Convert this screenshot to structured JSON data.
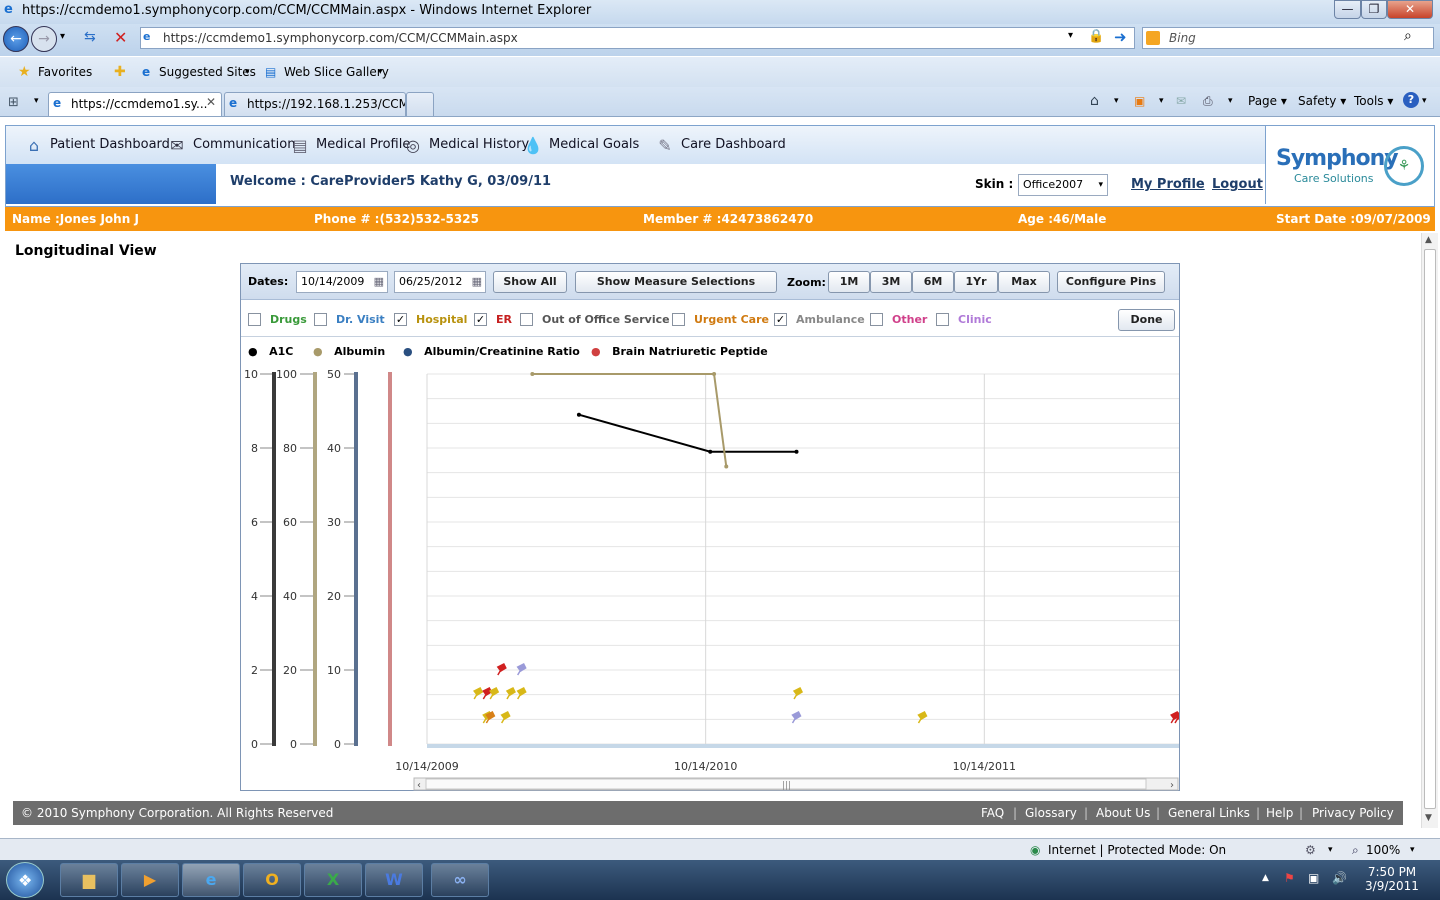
{
  "window": {
    "title": "https://ccmdemo1.symphonycorp.com/CCM/CCMMain.aspx - Windows Internet Explorer",
    "url": "https://ccmdemo1.symphonycorp.com/CCM/CCMMain.aspx",
    "search_placeholder": "Bing",
    "min_icon": "minimize-icon",
    "max_icon": "maximize-icon",
    "close_icon": "close-icon"
  },
  "favbar": {
    "favorites": "Favorites",
    "suggested": "Suggested Sites",
    "webslice": "Web Slice Gallery"
  },
  "tabs": [
    {
      "label": "https://ccmdemo1.sy..."
    },
    {
      "label": "https://192.168.1.253/CCM..."
    }
  ],
  "commandbar": {
    "page": "Page",
    "safety": "Safety",
    "tools": "Tools"
  },
  "nav": {
    "items": [
      {
        "label": "Patient Dashboard",
        "icon": "home-icon"
      },
      {
        "label": "Communication",
        "icon": "envelope-icon"
      },
      {
        "label": "Medical Profile",
        "icon": "clipboard-icon"
      },
      {
        "label": "Medical History",
        "icon": "spiral-icon"
      },
      {
        "label": "Medical Goals",
        "icon": "droplet-icon"
      },
      {
        "label": "Care Dashboard",
        "icon": "stethoscope-icon"
      }
    ]
  },
  "welcome": "Welcome : CareProvider5 Kathy G, 03/09/11",
  "skin": {
    "label": "Skin :",
    "value": "Office2007"
  },
  "links": {
    "profile": "My Profile",
    "logout": "Logout"
  },
  "logo": {
    "name": "Symphony",
    "tagline": "Care Solutions"
  },
  "patient": {
    "name": "Name :Jones John J",
    "phone": "Phone # :(532)532-5325",
    "member": "Member # :42473862470",
    "age": "Age :46/Male",
    "start": "Start Date :09/07/2009"
  },
  "view_title": "Longitudinal View",
  "toolbar": {
    "dates_label": "Dates:",
    "date_from": "10/14/2009",
    "date_to": "06/25/2012",
    "show_all": "Show All",
    "show_measures": "Show Measure Selections",
    "zoom_label": "Zoom:",
    "zoom": [
      "1M",
      "3M",
      "6M",
      "1Yr",
      "Max"
    ],
    "configure": "Configure Pins"
  },
  "filters": [
    {
      "label": "Drugs",
      "checked": false,
      "color": "#3a9a3a"
    },
    {
      "label": "Dr. Visit",
      "checked": false,
      "color": "#3a7fc2"
    },
    {
      "label": "Hospital",
      "checked": true,
      "color": "#b8920e"
    },
    {
      "label": "ER",
      "checked": true,
      "color": "#c62020"
    },
    {
      "label": "Out of Office Service",
      "checked": false,
      "color": "#555555"
    },
    {
      "label": "Urgent Care",
      "checked": false,
      "color": "#d07a10"
    },
    {
      "label": "Ambulance",
      "checked": true,
      "color": "#888888"
    },
    {
      "label": "Other",
      "checked": false,
      "color": "#d0408a"
    },
    {
      "label": "Clinic",
      "checked": false,
      "color": "#b07ad8"
    }
  ],
  "done": "Done",
  "chart_data": {
    "type": "line",
    "x_ticks": [
      "10/14/2009",
      "10/14/2010",
      "10/14/2011"
    ],
    "x_range": [
      "10/14/2009",
      "06/25/2012"
    ],
    "series": [
      {
        "name": "A1C",
        "color": "#000000",
        "axis": [
          0,
          10
        ],
        "ticks": [
          "0",
          "2",
          "4",
          "6",
          "8",
          "10"
        ],
        "points": [
          [
            "2010-05-01",
            8.9
          ],
          [
            "2010-10-20",
            7.9
          ],
          [
            "2011-02-10",
            7.9
          ]
        ]
      },
      {
        "name": "Albumin",
        "color": "#a89a6a",
        "axis": [
          0,
          100
        ],
        "ticks": [
          "0",
          "20",
          "40",
          "60",
          "80",
          "100"
        ],
        "points": [
          [
            "2010-03-01",
            100
          ],
          [
            "2010-10-25",
            100
          ],
          [
            "2010-11-10",
            75
          ]
        ]
      },
      {
        "name": "Albumin/Creatinine Ratio",
        "color": "#2a4f80",
        "axis": [
          0,
          50
        ],
        "ticks": [
          "0",
          "10",
          "20",
          "30",
          "40",
          "50"
        ],
        "points": []
      },
      {
        "name": "Brain Natriuretic Peptide",
        "color": "#d04040",
        "axis": [
          0,
          0
        ],
        "ticks": [],
        "points": []
      }
    ],
    "pins": [
      {
        "date": "2010-01-20",
        "row": 3,
        "color": "#d02020"
      },
      {
        "date": "2010-02-15",
        "row": 3,
        "color": "#9a9ad8"
      },
      {
        "date": "2009-12-20",
        "row": 2,
        "color": "#d8b818"
      },
      {
        "date": "2010-01-01",
        "row": 2,
        "color": "#d02020"
      },
      {
        "date": "2010-01-10",
        "row": 2,
        "color": "#d8b818"
      },
      {
        "date": "2010-02-01",
        "row": 2,
        "color": "#d8b818"
      },
      {
        "date": "2010-02-15",
        "row": 2,
        "color": "#d8b818"
      },
      {
        "date": "2010-01-01",
        "row": 1,
        "color": "#d8b818"
      },
      {
        "date": "2010-01-05",
        "row": 1,
        "color": "#d88018"
      },
      {
        "date": "2010-01-25",
        "row": 1,
        "color": "#d8b818"
      },
      {
        "date": "2011-02-12",
        "row": 2,
        "color": "#d8b818"
      },
      {
        "date": "2011-02-10",
        "row": 1,
        "color": "#9a9ad8"
      },
      {
        "date": "2011-07-25",
        "row": 1,
        "color": "#d8b818"
      },
      {
        "date": "2012-06-20",
        "row": 1,
        "color": "#d02020"
      },
      {
        "date": "2012-06-25",
        "row": 1,
        "color": "#d02020"
      }
    ]
  },
  "footer": {
    "copyright": "© 2010 Symphony Corporation. All Rights Reserved",
    "links": [
      "FAQ",
      "Glossary",
      "About Us",
      "General Links",
      "Help",
      "Privacy Policy"
    ]
  },
  "status": {
    "zone": "Internet | Protected Mode: On",
    "zoom": "100%"
  },
  "clock": {
    "time": "7:50 PM",
    "date": "3/9/2011"
  }
}
